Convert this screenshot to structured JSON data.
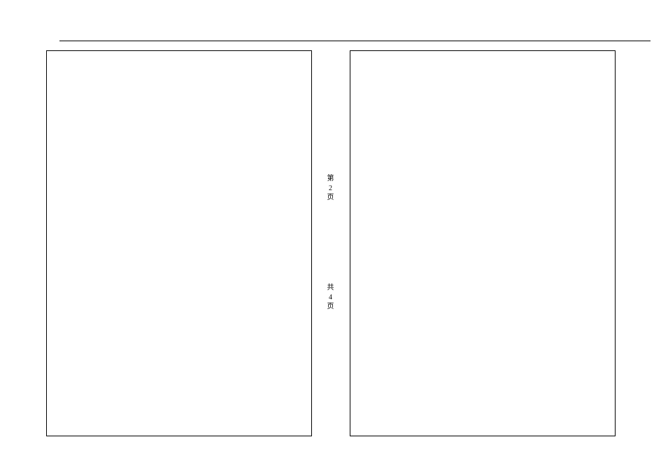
{
  "pagination": {
    "current_prefix": "第",
    "current_number": "2",
    "current_suffix": "页",
    "total_prefix": "共",
    "total_number": "4",
    "total_suffix": "页"
  }
}
